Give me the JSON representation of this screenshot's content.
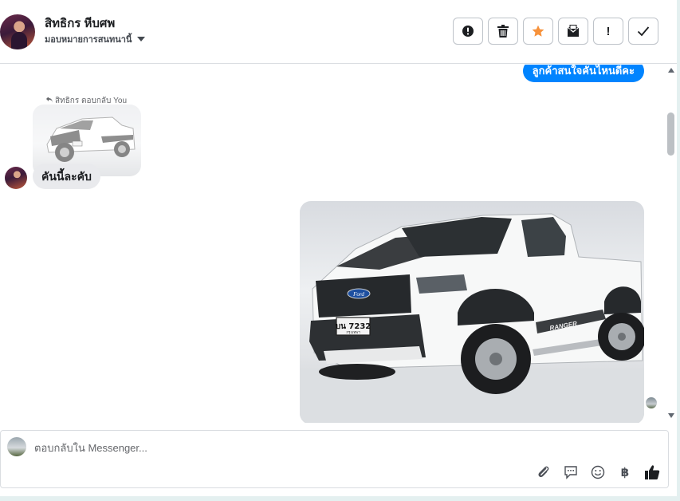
{
  "header": {
    "contact_name": "สิทธิกร หีบศพ",
    "assign_label": "มอบหมายการสนทนานี้",
    "actions": [
      {
        "name": "report-button",
        "icon": "alert-circle-icon"
      },
      {
        "name": "delete-button",
        "icon": "trash-icon"
      },
      {
        "name": "star-button",
        "icon": "star-icon",
        "color": "#f7923b"
      },
      {
        "name": "mark-unread-button",
        "icon": "envelope-icon"
      },
      {
        "name": "important-button",
        "icon": "exclamation-icon",
        "label": "!"
      },
      {
        "name": "done-button",
        "icon": "check-icon"
      }
    ]
  },
  "messages": {
    "outgoing_text": "ลูกค้าสนใจคันไหนดีคะ",
    "reply_label": "สิทธิกร ตอบกลับ You",
    "incoming_text": "คันนี้ละคับ",
    "accent_color": "#0084ff"
  },
  "car": {
    "plate_main": "บน 7232",
    "plate_sub": "กรุงเทพฯ",
    "badge": "Ford",
    "decal": "RANGER"
  },
  "composer": {
    "placeholder": "ตอบกลับใน Messenger...",
    "tools": [
      "attachment-icon",
      "saved-replies-icon",
      "emoji-icon",
      "baht-icon",
      "thumbs-up-icon"
    ],
    "baht_symbol": "฿"
  }
}
